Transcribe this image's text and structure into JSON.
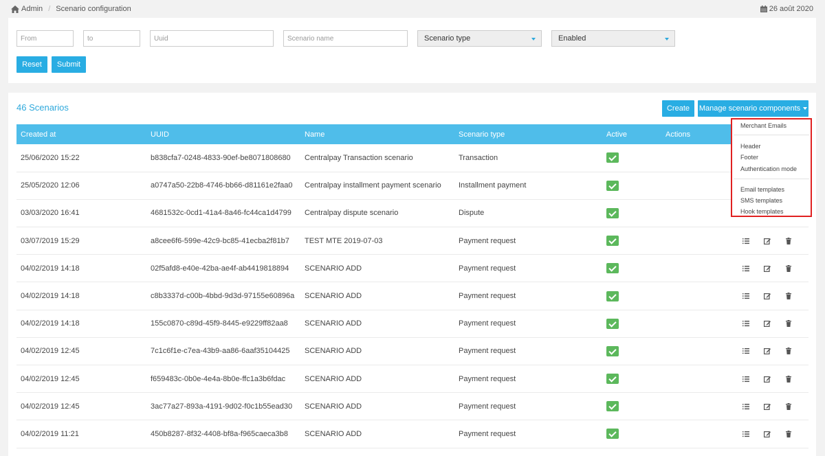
{
  "breadcrumb": {
    "home_icon": "home-icon",
    "root": "Admin",
    "current": "Scenario configuration"
  },
  "date": {
    "icon": "calendar-icon",
    "text": "26 août 2020"
  },
  "filters": {
    "from_placeholder": "From",
    "to_placeholder": "to",
    "uuid_placeholder": "Uuid",
    "name_placeholder": "Scenario name",
    "scenario_type_selected": "Scenario type",
    "enabled_selected": "Enabled",
    "reset_label": "Reset",
    "submit_label": "Submit"
  },
  "main": {
    "count_title": "46 Scenarios",
    "create_label": "Create",
    "manage_label": "Manage scenario components"
  },
  "dropdown": {
    "items": [
      "Merchant Emails",
      "Header",
      "Footer",
      "Authentication mode",
      "Email templates",
      "SMS templates",
      "Hook templates"
    ]
  },
  "table": {
    "headers": [
      "Created at",
      "UUID",
      "Name",
      "Scenario type",
      "Active",
      "Actions"
    ],
    "rows": [
      {
        "created": "25/06/2020 15:22",
        "uuid": "b838cfa7-0248-4833-90ef-be8071808680",
        "name": "Centralpay Transaction scenario",
        "type": "Transaction"
      },
      {
        "created": "25/05/2020 12:06",
        "uuid": "a0747a50-22b8-4746-bb66-d81161e2faa0",
        "name": "Centralpay installment payment scenario",
        "type": "Installment payment"
      },
      {
        "created": "03/03/2020 16:41",
        "uuid": "4681532c-0cd1-41a4-8a46-fc44ca1d4799",
        "name": "Centralpay dispute scenario",
        "type": "Dispute"
      },
      {
        "created": "03/07/2019 15:29",
        "uuid": "a8cee6f6-599e-42c9-bc85-41ecba2f81b7",
        "name": "TEST MTE 2019-07-03",
        "type": "Payment request"
      },
      {
        "created": "04/02/2019 14:18",
        "uuid": "02f5afd8-e40e-42ba-ae4f-ab4419818894",
        "name": "SCENARIO ADD",
        "type": "Payment request"
      },
      {
        "created": "04/02/2019 14:18",
        "uuid": "c8b3337d-c00b-4bbd-9d3d-97155e60896a",
        "name": "SCENARIO ADD",
        "type": "Payment request"
      },
      {
        "created": "04/02/2019 14:18",
        "uuid": "155c0870-c89d-45f9-8445-e9229ff82aa8",
        "name": "SCENARIO ADD",
        "type": "Payment request"
      },
      {
        "created": "04/02/2019 12:45",
        "uuid": "7c1c6f1e-c7ea-43b9-aa86-6aaf35104425",
        "name": "SCENARIO ADD",
        "type": "Payment request"
      },
      {
        "created": "04/02/2019 12:45",
        "uuid": "f659483c-0b0e-4e4a-8b0e-ffc1a3b6fdac",
        "name": "SCENARIO ADD",
        "type": "Payment request"
      },
      {
        "created": "04/02/2019 12:45",
        "uuid": "3ac77a27-893a-4191-9d02-f0c1b55ead30",
        "name": "SCENARIO ADD",
        "type": "Payment request"
      },
      {
        "created": "04/02/2019 11:21",
        "uuid": "450b8287-8f32-4408-bf8a-f965caeca3b8",
        "name": "SCENARIO ADD",
        "type": "Payment request"
      }
    ]
  },
  "colors": {
    "accent": "#29ade3",
    "header": "#4fbdea",
    "active": "#5cb85c",
    "highlight": "#e02020"
  }
}
